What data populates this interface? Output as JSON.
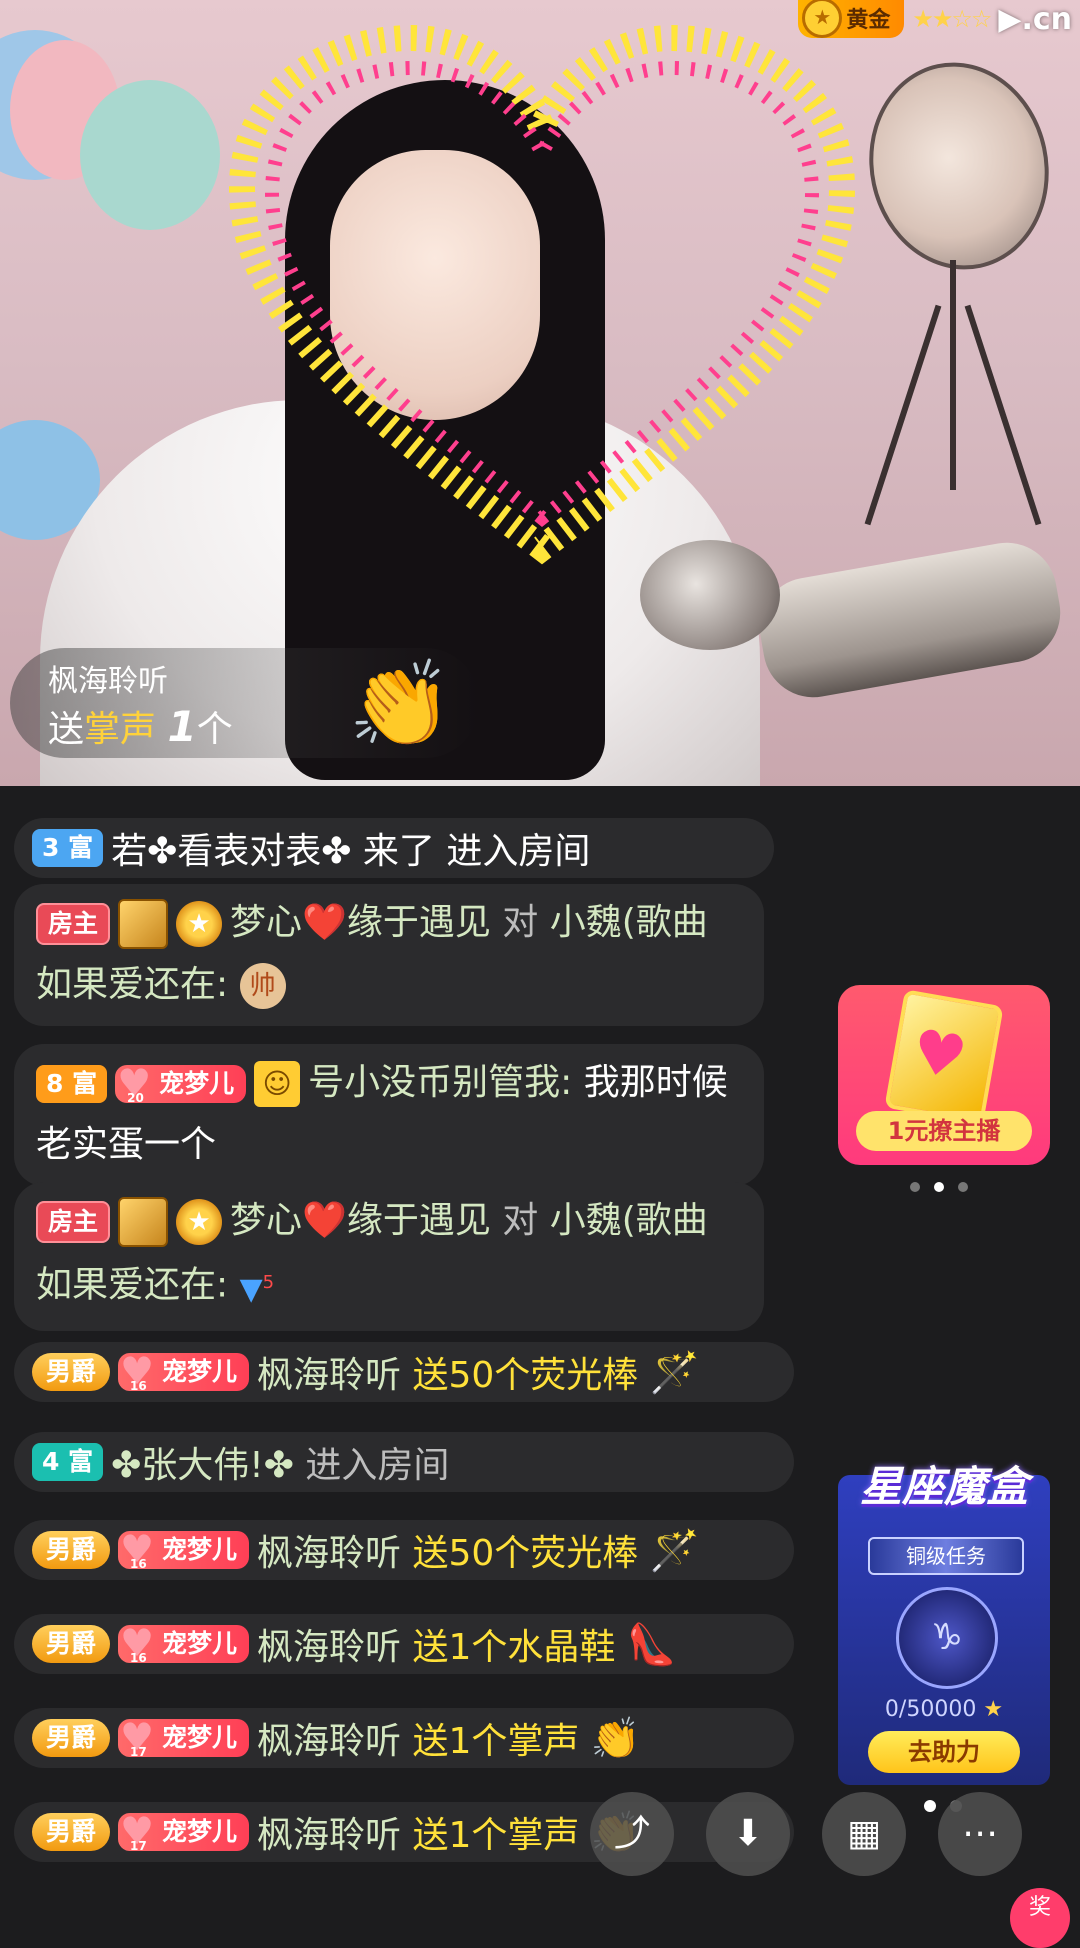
{
  "watermark": {
    "rank": "黄金",
    "stars": "★★☆☆",
    "domain": "cn"
  },
  "gift_banner": {
    "sender": "枫海聆听",
    "send": "送",
    "gift": "掌声",
    "count": "1",
    "unit": "个"
  },
  "chat": {
    "msg1": {
      "rank": "3 富",
      "text": "若✤看表对表✤ 来了 进入房间"
    },
    "msg2": {
      "tag": "房主",
      "user": "梦心❤️缘于遇见",
      "to": "对",
      "target": "小魏(歌曲如果爱还在:",
      "emoji": "帅"
    },
    "msg3": {
      "rank": "8 富",
      "fan_level": "20",
      "fan": "宠梦儿",
      "user": "号小没币别管我:",
      "text": "我那时候老实蛋一个"
    },
    "msg4": {
      "tag": "房主",
      "user": "梦心❤️缘于遇见",
      "to": "对",
      "target": "小魏(歌曲如果爱还在:",
      "emoji": "5"
    },
    "msg5": {
      "title": "男爵",
      "fan_level": "16",
      "fan": "宠梦儿",
      "user": "枫海聆听",
      "text": "送50个荧光棒"
    },
    "msg6": {
      "rank": "4 富",
      "user": "✤张大伟!✤",
      "text": "进入房间"
    },
    "msg7": {
      "title": "男爵",
      "fan_level": "16",
      "fan": "宠梦儿",
      "user": "枫海聆听",
      "text": "送50个荧光棒"
    },
    "msg8": {
      "title": "男爵",
      "fan_level": "16",
      "fan": "宠梦儿",
      "user": "枫海聆听",
      "text": "送1个水晶鞋"
    },
    "msg9": {
      "title": "男爵",
      "fan_level": "17",
      "fan": "宠梦儿",
      "user": "枫海聆听",
      "text": "送1个掌声"
    },
    "msg10": {
      "title": "男爵",
      "fan_level": "17",
      "fan": "宠梦儿",
      "user": "枫海聆听",
      "text": "送1个掌声"
    }
  },
  "promo": {
    "label": "1元撩主播"
  },
  "magic_box": {
    "title": "星座魔盒",
    "task": "铜级任务",
    "progress": "0/50000",
    "button": "去助力"
  },
  "toolbar": {
    "share_icon": "share-icon",
    "download_icon": "download-icon",
    "grid_icon": "grid-icon",
    "more_icon": "more-icon",
    "badge": "奖"
  },
  "colors": {
    "accent_yellow": "#ffe13a",
    "name_green": "#d5e8c2",
    "owner_red": "#e94a57"
  }
}
